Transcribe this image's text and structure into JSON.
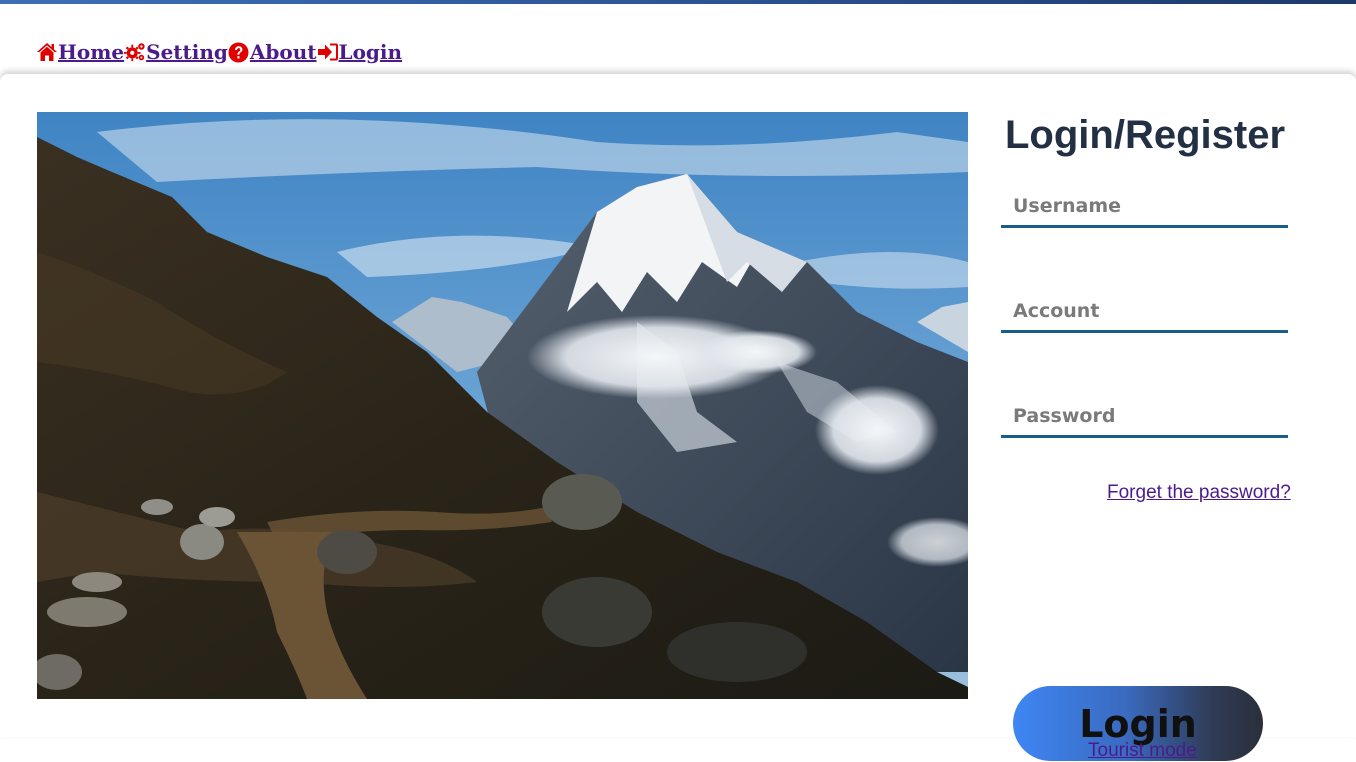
{
  "nav": {
    "items": [
      {
        "icon": "home-icon",
        "label": "Home"
      },
      {
        "icon": "gears-icon",
        "label": "Setting"
      },
      {
        "icon": "question-circle-icon",
        "label": "About"
      },
      {
        "icon": "sign-in-icon",
        "label": "Login"
      }
    ],
    "icon_color": "#e00000",
    "link_color": "#4b1b8c"
  },
  "form": {
    "title": "Login/Register",
    "username_placeholder": "Username",
    "account_placeholder": "Account",
    "password_placeholder": "Password",
    "forgot_label": "Forget the password?",
    "login_label": "Login",
    "tourist_label": "Tourist mode"
  },
  "colors": {
    "title": "#233044",
    "field_underline": "#1a5d8a",
    "accent_blue": "#3f86f4"
  }
}
